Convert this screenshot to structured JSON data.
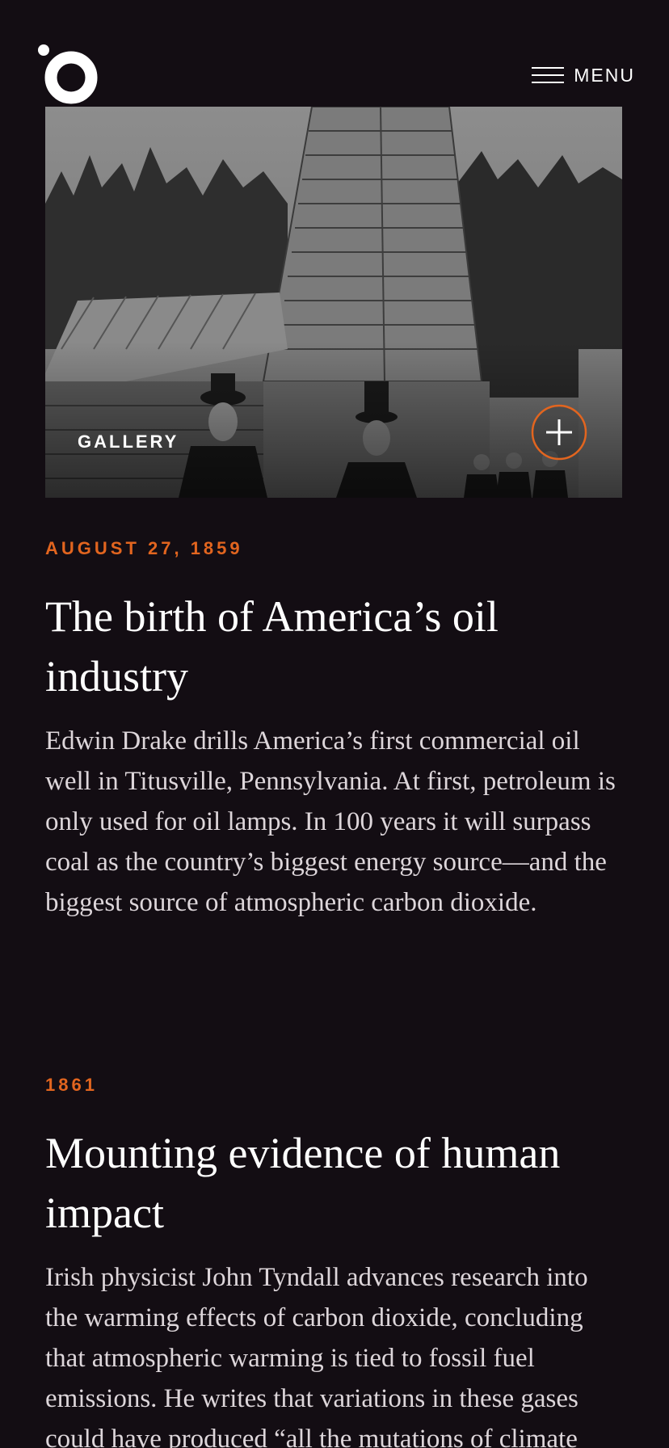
{
  "header": {
    "logo_icon": "ring-dot-logo-icon",
    "menu_icon": "hamburger-icon",
    "menu_label": "MENU"
  },
  "gallery": {
    "label": "GALLERY",
    "expand_icon": "plus-circle-icon",
    "accent_color": "#e2651f"
  },
  "entries": [
    {
      "date": "AUGUST 27, 1859",
      "title": "The birth of America’s oil industry",
      "body": "Edwin Drake drills America’s first commercial oil well in Titusville, Pennsylvania. At first, petroleum is only used for oil lamps. In 100 years it will surpass coal as the country’s biggest energy source—and the biggest source of atmospheric carbon dioxide."
    },
    {
      "date": "1861",
      "title": "Mounting evidence of human impact",
      "body": "Irish physicist John Tyndall advances research into the warming effects of carbon dioxide, concluding that atmospheric warming is tied to fossil fuel emissions. He writes that variations in these gases could have produced “all the mutations of climate"
    }
  ],
  "colors": {
    "background": "#130d13",
    "accent": "#e2651f",
    "text": "#ffffff"
  }
}
